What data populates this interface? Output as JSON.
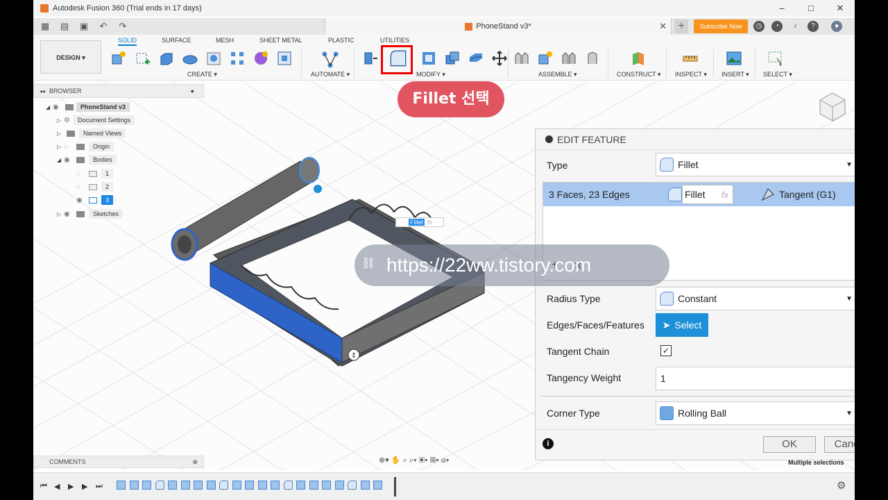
{
  "titlebar": {
    "title": "Autodesk Fusion 360 (Trial ends in 17 days)"
  },
  "tabbar": {
    "doc_title": "PhoneStand v3*",
    "subscribe": "Subscribe Now"
  },
  "ribbon": {
    "design": "DESIGN ▾",
    "tabs": [
      "SOLID",
      "SURFACE",
      "MESH",
      "SHEET METAL",
      "PLASTIC",
      "UTILITIES"
    ],
    "groups": [
      "CREATE ▾",
      "AUTOMATE ▾",
      "MODIFY ▾",
      "ASSEMBLE ▾",
      "CONSTRUCT ▾",
      "INSPECT ▾",
      "INSERT ▾",
      "SELECT ▾"
    ]
  },
  "annotation": {
    "text": "Fillet 선택"
  },
  "browser": {
    "title": "BROWSER",
    "root": "PhoneStand v3",
    "items": [
      "Document Settings",
      "Named Views",
      "Origin",
      "Bodies",
      "1",
      "2",
      "3",
      "Sketches"
    ]
  },
  "canvas_label": {
    "fillet": "Fillet",
    "fx": "fx"
  },
  "watermark": {
    "text": "https://22ww.tistory.com"
  },
  "edit_feature": {
    "title": "EDIT FEATURE",
    "type_label": "Type",
    "type_value": "Fillet",
    "selection_summary": "3 Faces, 23 Edges",
    "row_fillet": "Fillet",
    "row_fx": "fx",
    "row_tangent": "Tangent (G1)",
    "radius_type_label": "Radius Type",
    "radius_type_value": "Constant",
    "edges_label": "Edges/Faces/Features",
    "select_btn": "Select",
    "tangent_chain_label": "Tangent Chain",
    "tangency_weight_label": "Tangency Weight",
    "tangency_weight_value": "1",
    "corner_type_label": "Corner Type",
    "corner_type_value": "Rolling Ball",
    "ok": "OK",
    "cancel": "Cancel"
  },
  "comments": {
    "title": "COMMENTS"
  },
  "status": {
    "multiple_selections": "Multiple selections"
  },
  "colors": {
    "accent": "#0a7cc5",
    "highlight_red": "#e00000",
    "callout": "#e05560",
    "select_blue": "#1e90d8",
    "subscribe": "#f7941d"
  }
}
